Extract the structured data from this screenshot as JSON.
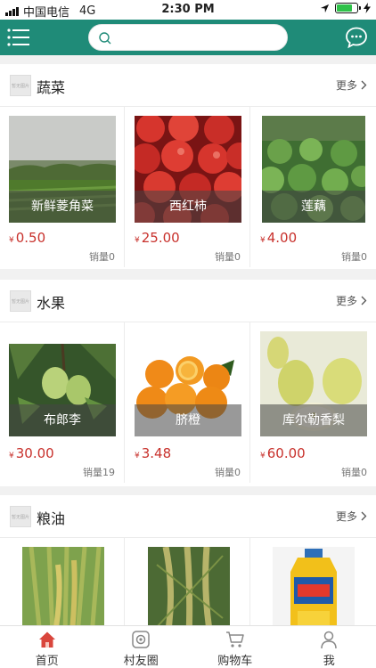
{
  "status_bar": {
    "carrier": "中国电信",
    "network": "4G",
    "time": "2:30 PM"
  },
  "search": {
    "placeholder": ""
  },
  "sections": [
    {
      "title": "蔬菜",
      "more": "更多",
      "logo_text": "暂无图片",
      "items": [
        {
          "name": "新鲜菱角菜",
          "currency": "¥",
          "price": "0.50",
          "sales": "销量0"
        },
        {
          "name": "西红柿",
          "currency": "¥",
          "price": "25.00",
          "sales": "销量0"
        },
        {
          "name": "莲藕",
          "currency": "¥",
          "price": "4.00",
          "sales": "销量0"
        }
      ]
    },
    {
      "title": "水果",
      "more": "更多",
      "logo_text": "暂无图片",
      "items": [
        {
          "name": "布郎李",
          "currency": "¥",
          "price": "30.00",
          "sales": "销量19"
        },
        {
          "name": "脐橙",
          "currency": "¥",
          "price": "3.48",
          "sales": "销量0"
        },
        {
          "name": "库尔勒香梨",
          "currency": "¥",
          "price": "60.00",
          "sales": "销量0"
        }
      ]
    },
    {
      "title": "粮油",
      "more": "更多",
      "logo_text": "暂无图片",
      "items": [
        {
          "name": "",
          "currency": "",
          "price": "",
          "sales": ""
        },
        {
          "name": "",
          "currency": "",
          "price": "",
          "sales": ""
        },
        {
          "name": "",
          "currency": "",
          "price": "",
          "sales": ""
        }
      ]
    }
  ],
  "bottom_nav": [
    {
      "label": "首页",
      "icon": "home-icon",
      "active": true
    },
    {
      "label": "村友圈",
      "icon": "camera-circle-icon",
      "active": false
    },
    {
      "label": "购物车",
      "icon": "cart-icon",
      "active": false
    },
    {
      "label": "我",
      "icon": "user-icon",
      "active": false
    }
  ],
  "colors": {
    "primary": "#1f8b78",
    "price": "#c8312c",
    "active_icon": "#d9463c"
  }
}
